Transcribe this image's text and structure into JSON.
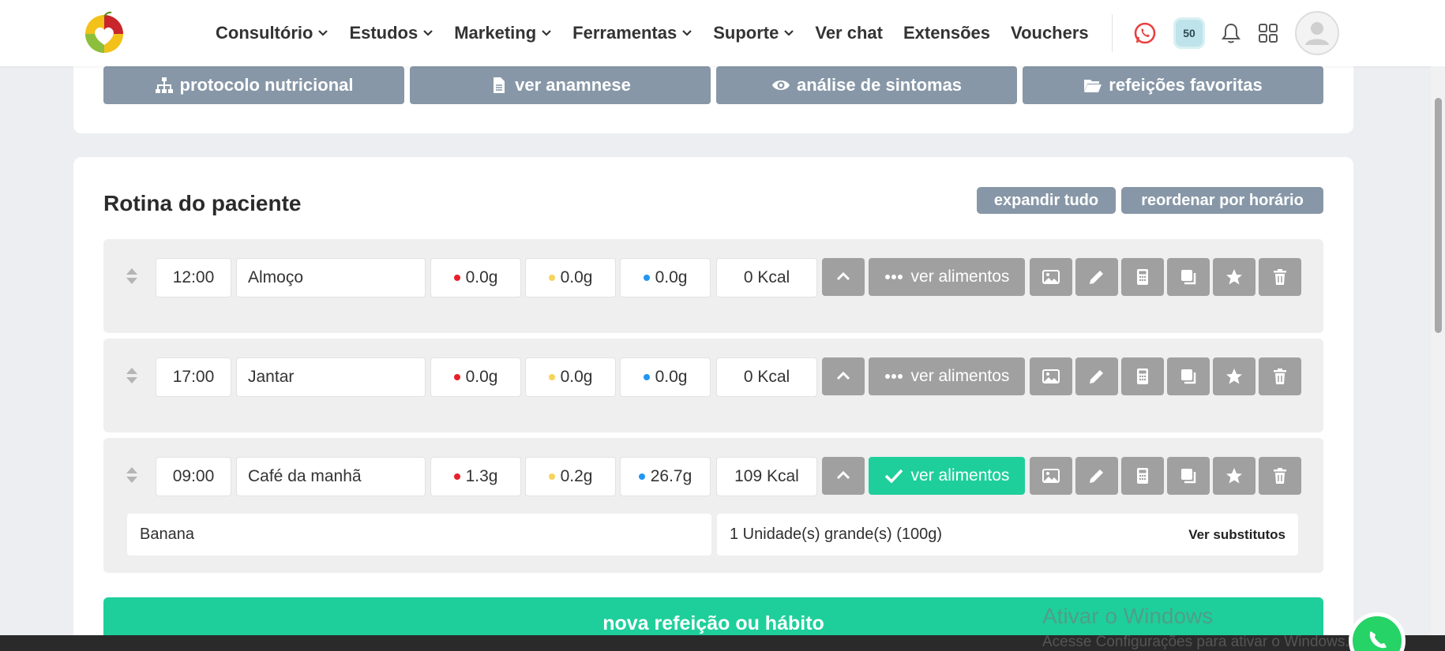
{
  "nav": {
    "items": [
      {
        "label": "Consultório",
        "dropdown": true
      },
      {
        "label": "Estudos",
        "dropdown": true
      },
      {
        "label": "Marketing",
        "dropdown": true
      },
      {
        "label": "Ferramentas",
        "dropdown": true
      },
      {
        "label": "Suporte",
        "dropdown": true
      },
      {
        "label": "Ver chat",
        "dropdown": false
      },
      {
        "label": "Extensões",
        "dropdown": false
      },
      {
        "label": "Vouchers",
        "dropdown": false
      }
    ],
    "badge_count": "50",
    "icons": [
      "whatsapp-icon",
      "credits-badge",
      "bell-icon",
      "apps-grid-icon",
      "avatar"
    ]
  },
  "top_buttons": {
    "protocol": "protocolo nutricional",
    "anamnese": "ver anamnese",
    "symptoms": "análise de sintomas",
    "favorites": "refeições favoritas"
  },
  "routine": {
    "title": "Rotina do paciente",
    "expand_all": "expandir tudo",
    "reorder": "reordenar por horário",
    "view_foods_label": "ver alimentos",
    "meals": [
      {
        "time": "12:00",
        "name": "Almoço",
        "protein": "0.0g",
        "fat": "0.0g",
        "carb": "0.0g",
        "kcal": "0 Kcal",
        "has_foods": false
      },
      {
        "time": "17:00",
        "name": "Jantar",
        "protein": "0.0g",
        "fat": "0.0g",
        "carb": "0.0g",
        "kcal": "0 Kcal",
        "has_foods": false
      },
      {
        "time": "09:00",
        "name": "Café da manhã",
        "protein": "1.3g",
        "fat": "0.2g",
        "carb": "26.7g",
        "kcal": "109 Kcal",
        "has_foods": true,
        "foods": [
          {
            "name": "Banana",
            "quantity": "1 Unidade(s) grande(s) (100g)",
            "substitutes": "Ver substitutos"
          }
        ]
      }
    ],
    "new_meal": "nova refeição ou hábito"
  },
  "colors": {
    "accent_green": "#1ecf9b",
    "slate_button": "#8797a7",
    "gray_button": "#a0a0a0",
    "protein_dot": "#e8202a",
    "fat_dot": "#f6d35b",
    "carb_dot": "#2196f3"
  },
  "watermark": {
    "line1": "Ativar o Windows",
    "line2": "Acesse Configurações para ativar o Windows."
  }
}
